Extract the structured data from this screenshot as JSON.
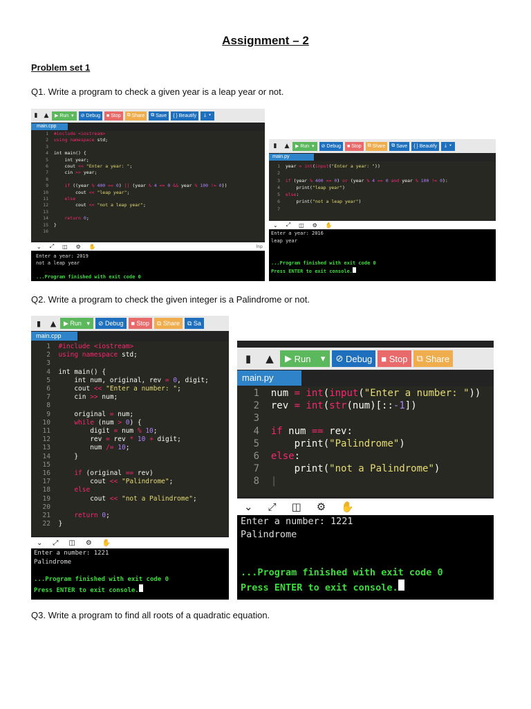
{
  "document": {
    "title": "Assignment – 2",
    "problem_set": "Problem set 1",
    "q1": "Q1. Write a program to check a given year is a leap year or not.",
    "q2": "Q2. Write a program to check the given integer is a Palindrome or not.",
    "q3": "Q3. Write a program to find all roots of a quadratic equation."
  },
  "toolbar": {
    "run": "Run",
    "debug": "Debug",
    "stop": "Stop",
    "share": "Share",
    "save": "Save",
    "beautify": "{ } Beautify",
    "save_short": "Sa"
  },
  "shot1": {
    "tab": "main.cpp",
    "line_numbers": [
      "1",
      "2",
      "3",
      "4",
      "5",
      "6",
      "7",
      "8",
      "9",
      "10",
      "11",
      "12",
      "13",
      "14",
      "15",
      "16"
    ],
    "console": [
      "Enter a year: 2019",
      "not a leap year",
      "",
      "...Program finished with exit code 0"
    ],
    "input_label": "Inp"
  },
  "shot2": {
    "tab": "main.py",
    "line_numbers": [
      "1",
      "2",
      "3",
      "4",
      "5",
      "6",
      "7"
    ],
    "console": [
      "Enter a year: 2016",
      "leap year",
      "",
      "",
      "...Program finished with exit code 0",
      "Press ENTER to exit console."
    ]
  },
  "shot3": {
    "tab": "main.cpp",
    "line_numbers": [
      "1",
      "2",
      "3",
      "4",
      "5",
      "6",
      "7",
      "8",
      "9",
      "10",
      "11",
      "12",
      "13",
      "14",
      "15",
      "16",
      "17",
      "18",
      "19",
      "20",
      "21",
      "22"
    ],
    "console": [
      "Enter a number: 1221",
      "Palindrome",
      "",
      "...Program finished with exit code 0",
      "Press ENTER to exit console."
    ]
  },
  "shot4": {
    "tab": "main.py",
    "line_numbers": [
      "1",
      "2",
      "3",
      "4",
      "5",
      "6",
      "7",
      "8"
    ],
    "console": [
      "Enter a number: 1221",
      "Palindrome",
      "",
      "",
      "...Program finished with exit code 0",
      "Press ENTER to exit console."
    ]
  },
  "icons": [
    "new-file-icon",
    "upload-icon",
    "play-icon",
    "debug-icon",
    "stop-icon",
    "share-icon",
    "save-icon",
    "download-icon",
    "chevron-down-icon",
    "expand-icon",
    "settings-icon",
    "gear-icon",
    "keyboard-icon"
  ]
}
